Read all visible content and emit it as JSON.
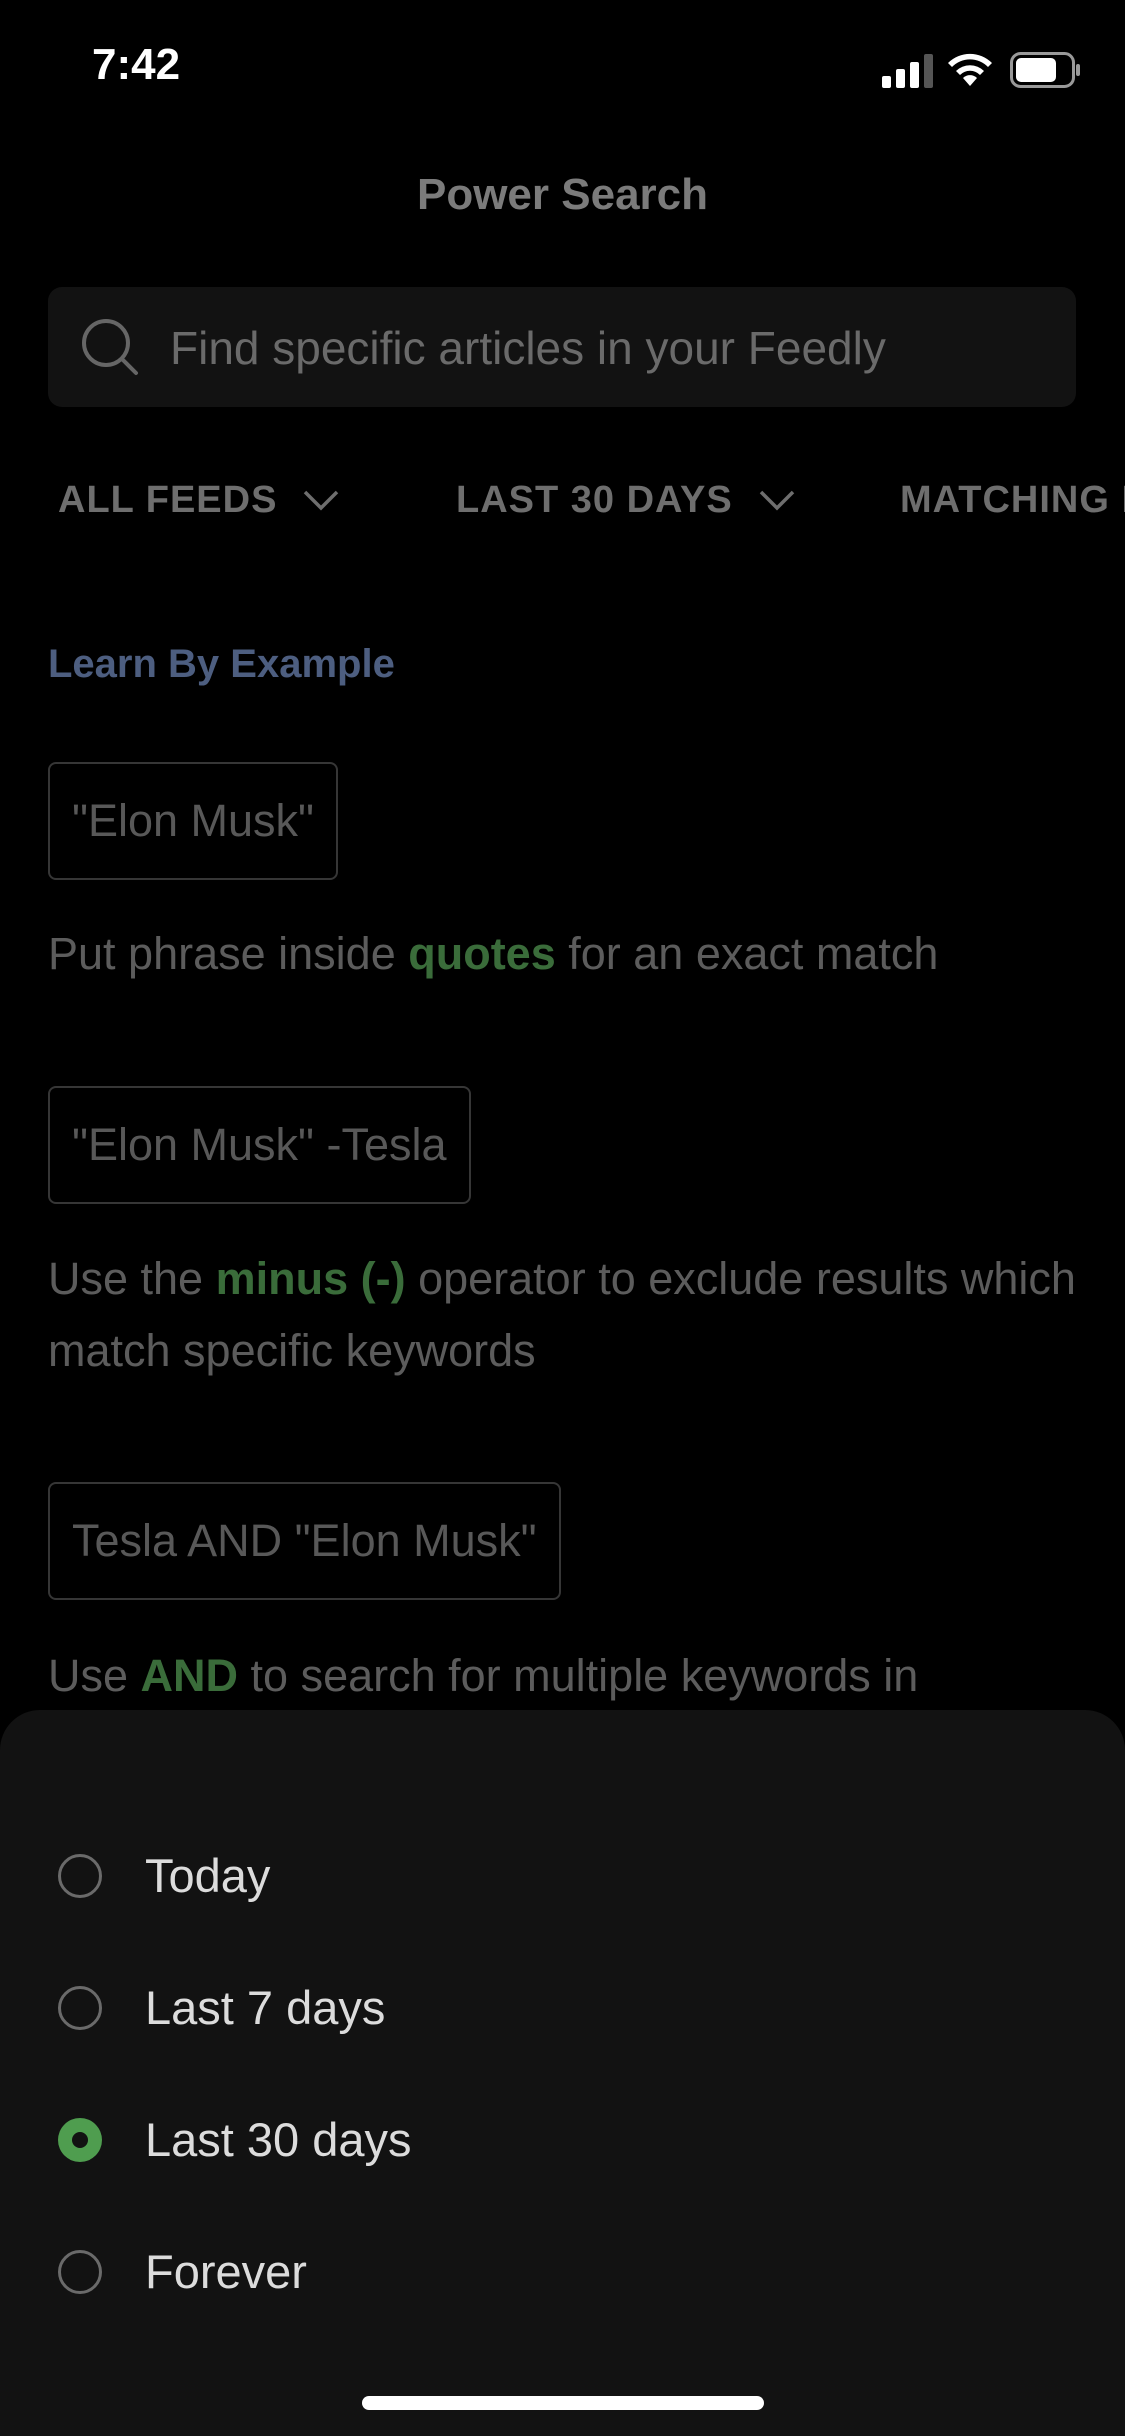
{
  "status_bar": {
    "time": "7:42"
  },
  "header": {
    "title": "Power Search"
  },
  "search": {
    "placeholder": "Find specific articles in your Feedly"
  },
  "filters": [
    {
      "label": "ALL FEEDS"
    },
    {
      "label": "LAST 30 DAYS"
    },
    {
      "label": "MATCHING I"
    }
  ],
  "learn": {
    "title": "Learn By Example"
  },
  "examples": [
    {
      "query": "\"Elon Musk\"",
      "desc_before": "Put phrase inside ",
      "desc_bold": "quotes",
      "desc_after": " for an exact match"
    },
    {
      "query": "\"Elon Musk\" -Tesla",
      "desc_before": "Use the ",
      "desc_bold": "minus (-)",
      "desc_after": " operator to exclude results which match specific keywords"
    },
    {
      "query": "Tesla AND \"Elon Musk\"",
      "desc_before": "Use ",
      "desc_bold": "AND",
      "desc_after": " to search for multiple keywords in"
    }
  ],
  "date_options": [
    {
      "label": "Today",
      "selected": false
    },
    {
      "label": "Last 7 days",
      "selected": false
    },
    {
      "label": "Last 30 days",
      "selected": true
    },
    {
      "label": "Forever",
      "selected": false
    }
  ],
  "colors": {
    "accent": "#4f9d4f",
    "link": "#4d5e80",
    "sheet": "#121212"
  }
}
